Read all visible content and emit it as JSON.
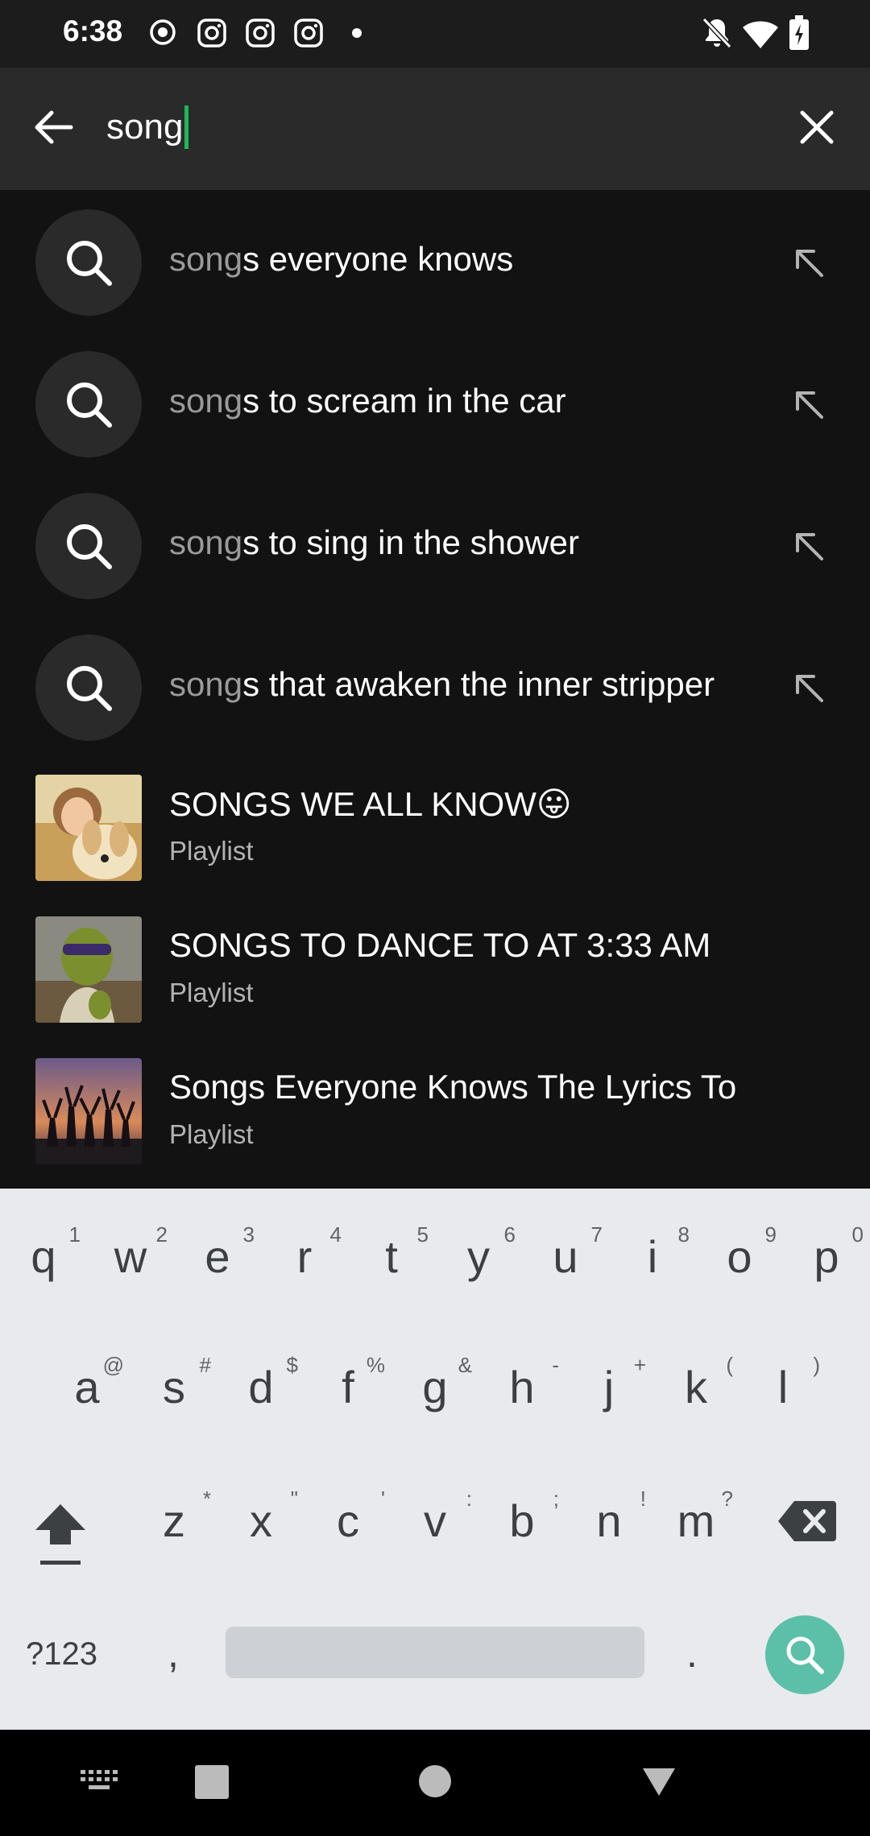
{
  "status_bar": {
    "time": "6:38",
    "left_icons": [
      "record-icon",
      "instagram-icon",
      "instagram-icon",
      "instagram-icon",
      "dot-icon"
    ],
    "right_icons": [
      "notifications-off-icon",
      "wifi-icon",
      "battery-charging-icon"
    ]
  },
  "search": {
    "query": "song",
    "back_icon": "arrow-left-icon",
    "clear_icon": "close-icon",
    "accent_color": "#1db954"
  },
  "suggestions": [
    {
      "typed": "song",
      "rest": "s everyone knows"
    },
    {
      "typed": "song",
      "rest": "s to scream in the car"
    },
    {
      "typed": "song",
      "rest": "s to sing in the shower"
    },
    {
      "typed": "song",
      "rest": "s that awaken the inner stripper"
    }
  ],
  "playlists": [
    {
      "title": "SONGS WE ALL KNOW😛",
      "subtitle": "Playlist",
      "thumb": "girl-with-puppy"
    },
    {
      "title": "SONGS TO DANCE TO AT 3:33 AM",
      "subtitle": "Playlist",
      "thumb": "shrek"
    },
    {
      "title": "Songs Everyone Knows The Lyrics To",
      "subtitle": "Playlist",
      "thumb": "silhouettes-sunset"
    }
  ],
  "keyboard": {
    "row1": [
      {
        "k": "q",
        "h": "1"
      },
      {
        "k": "w",
        "h": "2"
      },
      {
        "k": "e",
        "h": "3"
      },
      {
        "k": "r",
        "h": "4"
      },
      {
        "k": "t",
        "h": "5"
      },
      {
        "k": "y",
        "h": "6"
      },
      {
        "k": "u",
        "h": "7"
      },
      {
        "k": "i",
        "h": "8"
      },
      {
        "k": "o",
        "h": "9"
      },
      {
        "k": "p",
        "h": "0"
      }
    ],
    "row2": [
      {
        "k": "a",
        "h": "@"
      },
      {
        "k": "s",
        "h": "#"
      },
      {
        "k": "d",
        "h": "$"
      },
      {
        "k": "f",
        "h": "%"
      },
      {
        "k": "g",
        "h": "&"
      },
      {
        "k": "h",
        "h": "-"
      },
      {
        "k": "j",
        "h": "+"
      },
      {
        "k": "k",
        "h": "("
      },
      {
        "k": "l",
        "h": ")"
      }
    ],
    "row3": [
      {
        "k": "z",
        "h": "*"
      },
      {
        "k": "x",
        "h": "\""
      },
      {
        "k": "c",
        "h": "'"
      },
      {
        "k": "v",
        "h": ":"
      },
      {
        "k": "b",
        "h": ";"
      },
      {
        "k": "n",
        "h": "!"
      },
      {
        "k": "m",
        "h": "?"
      }
    ],
    "symbols_label": "?123",
    "comma": ",",
    "period": ".",
    "go_color": "#5cbfa8"
  },
  "nav_bar": {
    "icons": [
      "keyboard-switch-icon",
      "recents-icon",
      "home-icon",
      "back-icon"
    ]
  }
}
